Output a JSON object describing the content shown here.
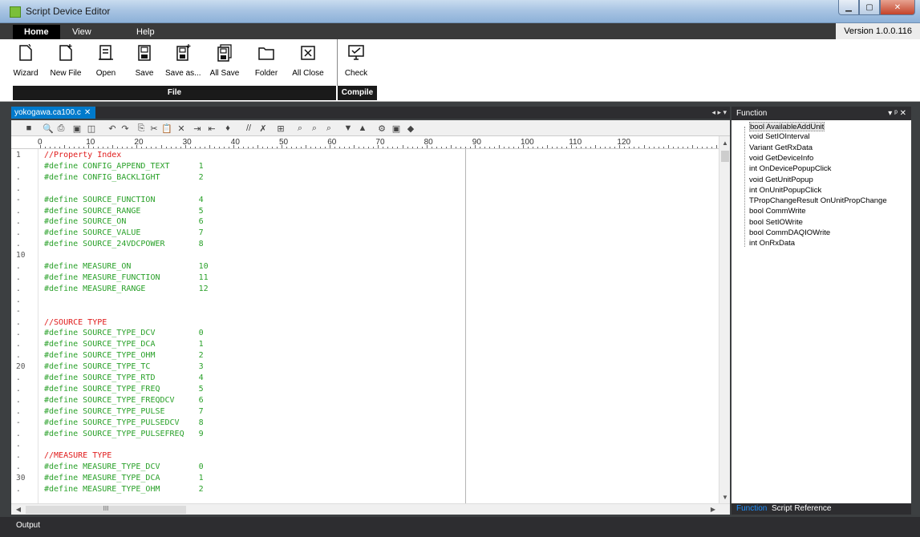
{
  "window": {
    "title": "Script Device Editor"
  },
  "menu_tabs": [
    {
      "label": "Home",
      "active": true
    },
    {
      "label": "View",
      "active": false
    },
    {
      "label": "Help",
      "active": false
    }
  ],
  "version": "Version 1.0.0.116",
  "ribbon": {
    "file_buttons": [
      {
        "label": "Wizard",
        "icon": "wizard-icon"
      },
      {
        "label": "New File",
        "icon": "new-file-icon"
      },
      {
        "label": "Open",
        "icon": "open-icon"
      },
      {
        "label": "Save",
        "icon": "save-icon"
      },
      {
        "label": "Save as...",
        "icon": "save-as-icon"
      },
      {
        "label": "All Save",
        "icon": "all-save-icon"
      },
      {
        "label": "Folder",
        "icon": "folder-icon"
      },
      {
        "label": "All Close",
        "icon": "all-close-icon"
      }
    ],
    "compile_buttons": [
      {
        "label": "Check",
        "icon": "check-icon"
      }
    ],
    "groups": {
      "file": "File",
      "compile": "Compile"
    }
  },
  "document": {
    "tab_title": "yokogawa.ca100.c",
    "close_glyph": "✕",
    "nav_arrows": "◂ ▸ ▾"
  },
  "ruler_numbers": [
    "0",
    "10",
    "20",
    "30",
    "40",
    "50",
    "60",
    "70",
    "80",
    "90",
    "100",
    "110",
    "120"
  ],
  "code_lines": [
    {
      "marker": "1",
      "text": "//Property Index",
      "comment": true
    },
    {
      "marker": ".",
      "text": "#define CONFIG_APPEND_TEXT      1",
      "comment": false
    },
    {
      "marker": ".",
      "text": "#define CONFIG_BACKLIGHT        2",
      "comment": false
    },
    {
      "marker": ".",
      "text": "",
      "comment": false
    },
    {
      "marker": "-",
      "text": "#define SOURCE_FUNCTION         4",
      "comment": false
    },
    {
      "marker": ".",
      "text": "#define SOURCE_RANGE            5",
      "comment": false
    },
    {
      "marker": ".",
      "text": "#define SOURCE_ON               6",
      "comment": false
    },
    {
      "marker": ".",
      "text": "#define SOURCE_VALUE            7",
      "comment": false
    },
    {
      "marker": ".",
      "text": "#define SOURCE_24VDCPOWER       8",
      "comment": false
    },
    {
      "marker": "10",
      "text": "",
      "comment": false
    },
    {
      "marker": ".",
      "text": "#define MEASURE_ON              10",
      "comment": false
    },
    {
      "marker": ".",
      "text": "#define MEASURE_FUNCTION        11",
      "comment": false
    },
    {
      "marker": ".",
      "text": "#define MEASURE_RANGE           12",
      "comment": false
    },
    {
      "marker": ".",
      "text": "",
      "comment": false
    },
    {
      "marker": "-",
      "text": "",
      "comment": false
    },
    {
      "marker": ".",
      "text": "//SOURCE TYPE",
      "comment": true
    },
    {
      "marker": ".",
      "text": "#define SOURCE_TYPE_DCV         0",
      "comment": false
    },
    {
      "marker": ".",
      "text": "#define SOURCE_TYPE_DCA         1",
      "comment": false
    },
    {
      "marker": ".",
      "text": "#define SOURCE_TYPE_OHM         2",
      "comment": false
    },
    {
      "marker": "20",
      "text": "#define SOURCE_TYPE_TC          3",
      "comment": false
    },
    {
      "marker": ".",
      "text": "#define SOURCE_TYPE_RTD         4",
      "comment": false
    },
    {
      "marker": ".",
      "text": "#define SOURCE_TYPE_FREQ        5",
      "comment": false
    },
    {
      "marker": ".",
      "text": "#define SOURCE_TYPE_FREQDCV     6",
      "comment": false
    },
    {
      "marker": ".",
      "text": "#define SOURCE_TYPE_PULSE       7",
      "comment": false
    },
    {
      "marker": "-",
      "text": "#define SOURCE_TYPE_PULSEDCV    8",
      "comment": false
    },
    {
      "marker": ".",
      "text": "#define SOURCE_TYPE_PULSEFREQ   9",
      "comment": false
    },
    {
      "marker": ".",
      "text": "",
      "comment": false
    },
    {
      "marker": ".",
      "text": "//MEASURE TYPE",
      "comment": true
    },
    {
      "marker": ".",
      "text": "#define MEASURE_TYPE_DCV        0",
      "comment": false
    },
    {
      "marker": "30",
      "text": "#define MEASURE_TYPE_DCA        1",
      "comment": false
    },
    {
      "marker": ".",
      "text": "#define MEASURE_TYPE_OHM        2",
      "comment": false
    }
  ],
  "function_panel": {
    "title": "Function",
    "controls": "▾ ᵖ ✕",
    "items": [
      "bool AvailableAddUnit",
      "void SetIOInterval",
      "Variant GetRxData",
      "void GetDeviceInfo",
      "int OnDevicePopupClick",
      "void GetUnitPopup",
      "int OnUnitPopupClick",
      "TPropChangeResult OnUnitPropChange",
      "bool CommWrite",
      "bool SetIOWrite",
      "bool CommDAQIOWrite",
      "int OnRxData"
    ],
    "selected_index": 0,
    "tabs": [
      "Function",
      "Script Reference"
    ]
  },
  "output": {
    "label": "Output"
  },
  "hscroll": {
    "thumb_glyph": "III"
  },
  "colors": {
    "accent": "#007acc",
    "comment": "#e01b1b",
    "code": "#2aa12a"
  }
}
